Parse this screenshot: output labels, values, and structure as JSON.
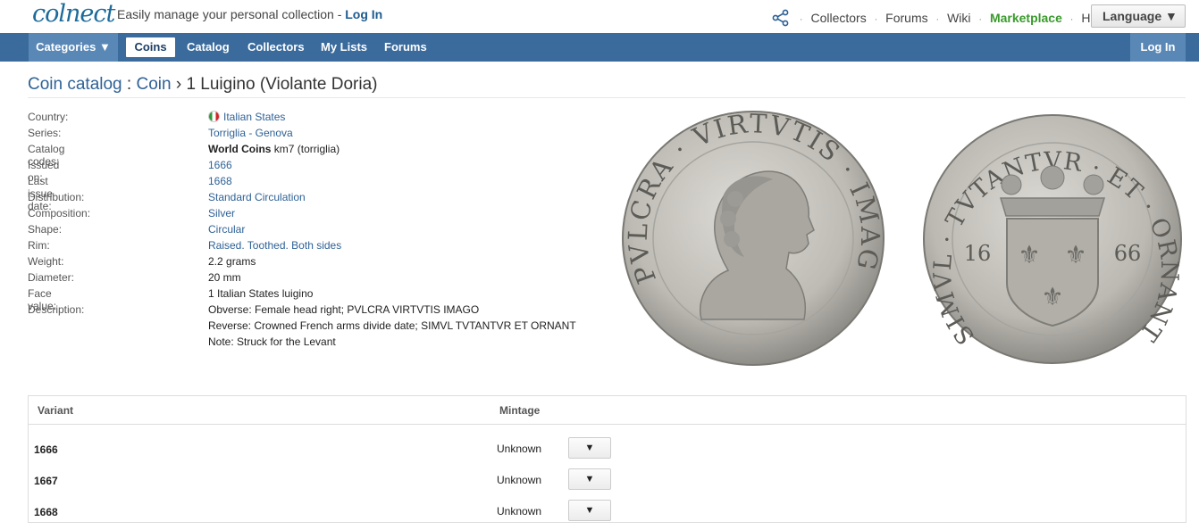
{
  "header": {
    "logo": "colnect",
    "tagline": "Easily manage your personal collection - ",
    "tagline_login": "Log In",
    "links": [
      "Collectors",
      "Forums",
      "Wiki"
    ],
    "marketplace": "Marketplace",
    "help": "Help",
    "help_icon": "?",
    "language": "Language ▼"
  },
  "nav": {
    "categories": "Categories ▼",
    "items": [
      "Coins",
      "Catalog",
      "Collectors",
      "My Lists",
      "Forums"
    ],
    "login": "Log In"
  },
  "breadcrumb": {
    "root": "Coin catalog",
    "sep1": " : ",
    "section": "Coin",
    "sep2": " › ",
    "title": "1 Luigino (Violante Doria)"
  },
  "details": {
    "country_label": "Country:",
    "country": "Italian States",
    "series_label": "Series:",
    "series": "Torriglia - Genova",
    "codes_label": "Catalog codes:",
    "codes_bold": "World Coins",
    "codes_rest": " km7 (torriglia)",
    "issued_label": "Issued on:",
    "issued": "1666",
    "last_label": "Last issue date:",
    "last": "1668",
    "distribution_label": "Distribution:",
    "distribution": "Standard Circulation",
    "composition_label": "Composition:",
    "composition": "Silver",
    "shape_label": "Shape:",
    "shape": "Circular",
    "rim_label": "Rim:",
    "rim": "Raised. Toothed. Both sides",
    "weight_label": "Weight:",
    "weight": "2.2 grams",
    "diameter_label": "Diameter:",
    "diameter": "20 mm",
    "face_label": "Face value:",
    "face": "1 Italian States luigino",
    "description_label": "Description:",
    "obverse": "Obverse: Female head right; PVLCRA VIRTVTIS IMAGO",
    "reverse": "Reverse: Crowned French arms divide date; SIMVL TVTANTVR ET ORNANT",
    "note": "Note: Struck for the Levant"
  },
  "coins": {
    "obverse_legend": "PVLCRA · VIRTVTIS · IMAGO ·",
    "reverse_legend": "SIMVL · TVTANTVR · ET · ORNANT · 7 ·",
    "date_left": "16",
    "date_right": "66"
  },
  "variants": {
    "header_variant": "Variant",
    "header_mintage": "Mintage",
    "rows": [
      {
        "year": "1666",
        "mintage": "Unknown",
        "btn": "▼"
      },
      {
        "year": "1667",
        "mintage": "Unknown",
        "btn": "▼"
      },
      {
        "year": "1668",
        "mintage": "Unknown",
        "btn": "▼"
      }
    ]
  },
  "colors": {
    "nav_bg": "#3a6b9c",
    "link": "#2f6296",
    "marketplace": "#3a9a2c",
    "coin_silver": "#bdbbb4"
  }
}
